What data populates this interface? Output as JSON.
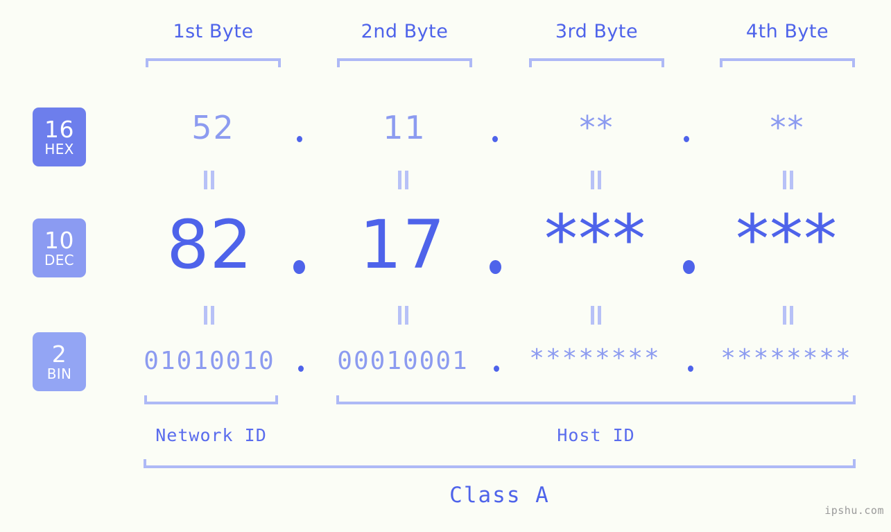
{
  "background_color": "#fbfdf6",
  "accent_color": "#4e63ea",
  "accent_light_color": "#8c9bf0",
  "bracket_color": "#aeb9f6",
  "byte_headers": [
    {
      "label": "1st Byte"
    },
    {
      "label": "2nd Byte"
    },
    {
      "label": "3rd Byte"
    },
    {
      "label": "4th Byte"
    }
  ],
  "rows": [
    {
      "badge_number": "16",
      "badge_name": "HEX",
      "badge_color": "#6d7eec",
      "values": [
        "52",
        "11",
        "**",
        "**"
      ]
    },
    {
      "badge_number": "10",
      "badge_name": "DEC",
      "badge_color": "#8b9bf2",
      "values": [
        "82",
        "17",
        "***",
        "***"
      ]
    },
    {
      "badge_number": "2",
      "badge_name": "BIN",
      "badge_color": "#93a5f4",
      "values": [
        "01010010",
        "00010001",
        "********",
        "********"
      ]
    }
  ],
  "separator": ".",
  "equals_symbol": "=",
  "sections": [
    {
      "label": "Network ID"
    },
    {
      "label": "Host ID"
    }
  ],
  "class_label": "Class A",
  "watermark": "ipshu.com"
}
